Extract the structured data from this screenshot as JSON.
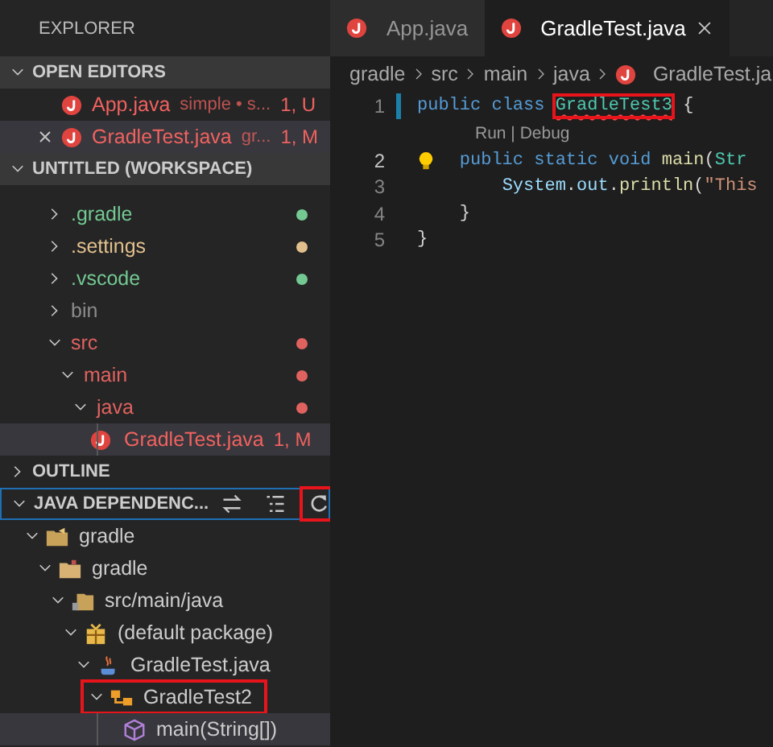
{
  "sidebar": {
    "title": "EXPLORER",
    "open_editors": {
      "title": "OPEN EDITORS",
      "expanded": true,
      "items": [
        {
          "label": "App.java",
          "description": "simple • s...",
          "badge": "1, U",
          "color": "#f0625f",
          "selected": false,
          "closable": false
        },
        {
          "label": "GradleTest.java",
          "description": "gr...",
          "badge": "1, M",
          "color": "#f0625f",
          "selected": true,
          "closable": true
        }
      ]
    },
    "workspace": {
      "title": "UNTITLED (WORKSPACE)",
      "expanded": true,
      "items": [
        {
          "label": ".gradle",
          "color": "#73c991",
          "expanded": false,
          "dot": true,
          "selected": false
        },
        {
          "label": ".settings",
          "color": "#e2c08d",
          "expanded": false,
          "dot": true,
          "selected": false
        },
        {
          "label": ".vscode",
          "color": "#73c991",
          "expanded": false,
          "dot": true,
          "selected": false
        },
        {
          "label": "bin",
          "color": "#8c8c8c",
          "expanded": false,
          "dot": false,
          "selected": false
        },
        {
          "label": "src",
          "color": "#e0625f",
          "expanded": true,
          "dot": true,
          "selected": false,
          "children": [
            {
              "label": "main",
              "color": "#e0625f",
              "expanded": true,
              "dot": true,
              "selected": false,
              "children": [
                {
                  "label": "java",
                  "color": "#e0625f",
                  "expanded": true,
                  "dot": true,
                  "selected": false,
                  "children": [
                    {
                      "label": "GradleTest.java",
                      "kind": "file",
                      "color": "#f0625f",
                      "badge": "1, M",
                      "selected": true
                    }
                  ]
                }
              ]
            }
          ]
        }
      ]
    },
    "outline": {
      "title": "OUTLINE",
      "expanded": false
    },
    "java_dependencies": {
      "title": "JAVA DEPENDENC...",
      "expanded": true,
      "focused": true,
      "actions": [
        {
          "kind": "swap",
          "annotated": false
        },
        {
          "kind": "list",
          "annotated": false
        },
        {
          "kind": "refresh",
          "annotated": true
        }
      ],
      "items": [
        {
          "label": "gradle",
          "kind": "project",
          "expanded": true,
          "selected": false,
          "annotated": false,
          "children": [
            {
              "label": "gradle",
              "kind": "folder",
              "expanded": true,
              "selected": false,
              "annotated": false,
              "children": [
                {
                  "label": "src/main/java",
                  "kind": "source",
                  "expanded": true,
                  "selected": false,
                  "annotated": false,
                  "children": [
                    {
                      "label": "(default package)",
                      "kind": "package",
                      "expanded": true,
                      "selected": false,
                      "annotated": false,
                      "children": [
                        {
                          "label": "GradleTest.java",
                          "kind": "javafile",
                          "expanded": true,
                          "selected": false,
                          "annotated": false,
                          "children": [
                            {
                              "label": "GradleTest2",
                              "kind": "class",
                              "expanded": true,
                              "selected": false,
                              "annotated": true,
                              "children": [
                                {
                                  "label": "main(String[])",
                                  "kind": "method",
                                  "selected": true,
                                  "annotated": false
                                }
                              ]
                            }
                          ]
                        }
                      ]
                    }
                  ]
                }
              ]
            }
          ]
        }
      ]
    }
  },
  "editor": {
    "tabs": [
      {
        "label": "App.java",
        "selected": false,
        "closable": false
      },
      {
        "label": "GradleTest.java",
        "selected": true,
        "closable": true
      }
    ],
    "breadcrumb": [
      {
        "label": "gradle",
        "kind": "folder"
      },
      {
        "label": "src",
        "kind": "folder"
      },
      {
        "label": "main",
        "kind": "folder"
      },
      {
        "label": "java",
        "kind": "folder"
      },
      {
        "label": "GradleTest.ja",
        "kind": "file"
      }
    ],
    "lines": [
      {
        "kind": "code",
        "number": "1",
        "active": false,
        "modified": true,
        "lightbulb": false,
        "tokens": [
          {
            "text": "public ",
            "kind": "keyword"
          },
          {
            "text": "class ",
            "kind": "keyword"
          },
          {
            "text": "GradleTest3",
            "kind": "type",
            "error": true,
            "annotated": true
          },
          {
            "text": " {",
            "kind": "plain"
          }
        ]
      },
      {
        "kind": "codelens",
        "text": "Run | Debug"
      },
      {
        "kind": "code",
        "number": "2",
        "active": true,
        "lightbulb": true,
        "tokens": [
          {
            "text": "    public ",
            "kind": "keyword"
          },
          {
            "text": "static ",
            "kind": "keyword"
          },
          {
            "text": "void ",
            "kind": "keyword"
          },
          {
            "text": "main",
            "kind": "method"
          },
          {
            "text": "(",
            "kind": "plain"
          },
          {
            "text": "Str",
            "kind": "type"
          }
        ]
      },
      {
        "kind": "code",
        "number": "3",
        "active": false,
        "lightbulb": false,
        "tokens": [
          {
            "text": "        System",
            "kind": "variable"
          },
          {
            "text": ".",
            "kind": "plain"
          },
          {
            "text": "out",
            "kind": "variable"
          },
          {
            "text": ".",
            "kind": "plain"
          },
          {
            "text": "println",
            "kind": "method"
          },
          {
            "text": "(",
            "kind": "plain"
          },
          {
            "text": "\"This",
            "kind": "string"
          }
        ]
      },
      {
        "kind": "code",
        "number": "4",
        "active": false,
        "lightbulb": false,
        "tokens": [
          {
            "text": "    }",
            "kind": "plain"
          }
        ]
      },
      {
        "kind": "code",
        "number": "5",
        "active": false,
        "lightbulb": false,
        "tokens": [
          {
            "text": "}",
            "kind": "plain"
          }
        ]
      }
    ]
  }
}
